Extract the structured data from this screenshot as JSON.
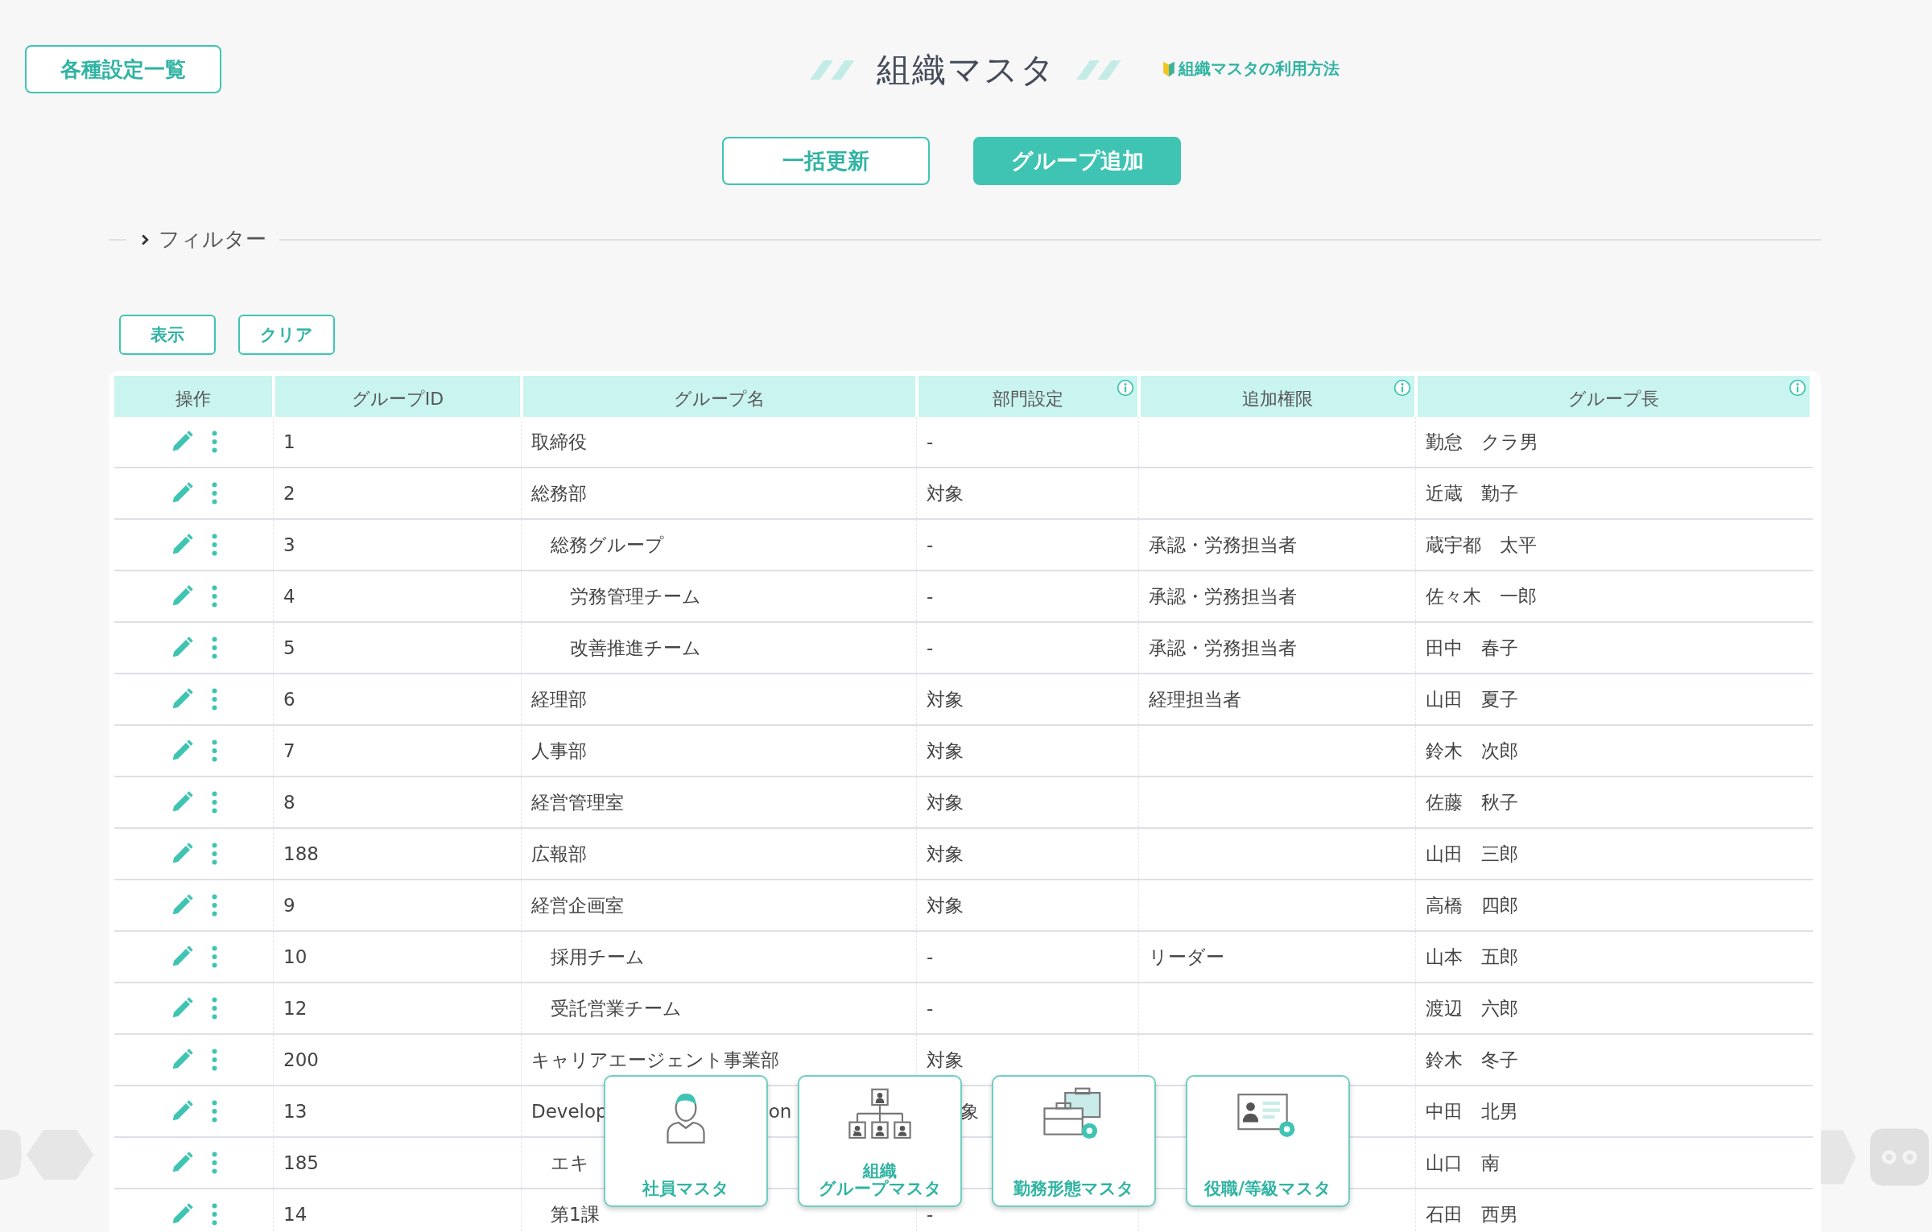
{
  "header": {
    "settings_button": "各種設定一覧",
    "title": "組織マスタ",
    "help_link": "組織マスタの利用方法"
  },
  "actions": [
    {
      "label": "一括更新",
      "kind": "outline"
    },
    {
      "label": "グループ追加",
      "kind": "filled"
    }
  ],
  "filter": {
    "label": "フィルター",
    "expanded": false
  },
  "filter_buttons": [
    "表示",
    "クリア"
  ],
  "table": {
    "columns": [
      {
        "label": "操作",
        "info": false
      },
      {
        "label": "グループID",
        "info": false
      },
      {
        "label": "グループ名",
        "info": false
      },
      {
        "label": "部門設定",
        "info": true
      },
      {
        "label": "追加権限",
        "info": true
      },
      {
        "label": "グループ長",
        "info": true
      }
    ],
    "rows": [
      {
        "id": "1",
        "name": "取締役",
        "dept": "-",
        "head": "勤怠　クラ男"
      },
      {
        "id": "2",
        "name": "総務部",
        "dept": "対象",
        "head": "近蔵　勤子",
        "children": [
          {
            "id": "3",
            "name": "総務グループ",
            "dept": "-",
            "perm": "承認・労務担当者",
            "head": "蔵宇都　太平",
            "children": [
              {
                "id": "4",
                "name": "労務管理チーム",
                "dept": "-",
                "perm": "承認・労務担当者",
                "head": "佐々木　一郎"
              },
              {
                "id": "5",
                "name": "改善推進チーム",
                "dept": "-",
                "perm": "承認・労務担当者",
                "head": "田中　春子"
              }
            ]
          }
        ]
      },
      {
        "id": "6",
        "name": "経理部",
        "dept": "対象",
        "perm": "経理担当者",
        "head": "山田　夏子"
      },
      {
        "id": "7",
        "name": "人事部",
        "dept": "対象",
        "head": "鈴木　次郎"
      },
      {
        "id": "8",
        "name": "経営管理室",
        "dept": "対象",
        "head": "佐藤　秋子"
      },
      {
        "id": "188",
        "name": "広報部",
        "dept": "対象",
        "head": "山田　三郎"
      },
      {
        "id": "9",
        "name": "経営企画室",
        "dept": "対象",
        "head": "高橋　四郎",
        "children": [
          {
            "id": "10",
            "name": "採用チーム",
            "dept": "-",
            "perm": "リーダー",
            "head": "山本　五郎"
          },
          {
            "id": "12",
            "name": "受託営業チーム",
            "dept": "-",
            "head": "渡辺　六郎"
          }
        ]
      },
      {
        "id": "200",
        "name": "キャリアエージェント事業部",
        "dept": "対象",
        "head": "鈴木　冬子"
      },
      {
        "id": "13",
        "name": "Develop",
        "name_tail": "on",
        "dept": "象",
        "head": "中田　北男",
        "children": [
          {
            "id": "185",
            "name": "エキ",
            "head": "山口　南"
          },
          {
            "id": "14",
            "name": "第1課",
            "dept": "-",
            "head": "石田　西男"
          }
        ]
      }
    ]
  },
  "shortcuts": [
    {
      "kind": "person",
      "lines": [
        "社員マスタ"
      ]
    },
    {
      "kind": "org",
      "lines": [
        "組織",
        "グループマスタ"
      ]
    },
    {
      "kind": "briefcase",
      "lines": [
        "勤務形態マスタ"
      ]
    },
    {
      "kind": "idcard",
      "lines": [
        "役職/等級マスタ"
      ]
    }
  ]
}
